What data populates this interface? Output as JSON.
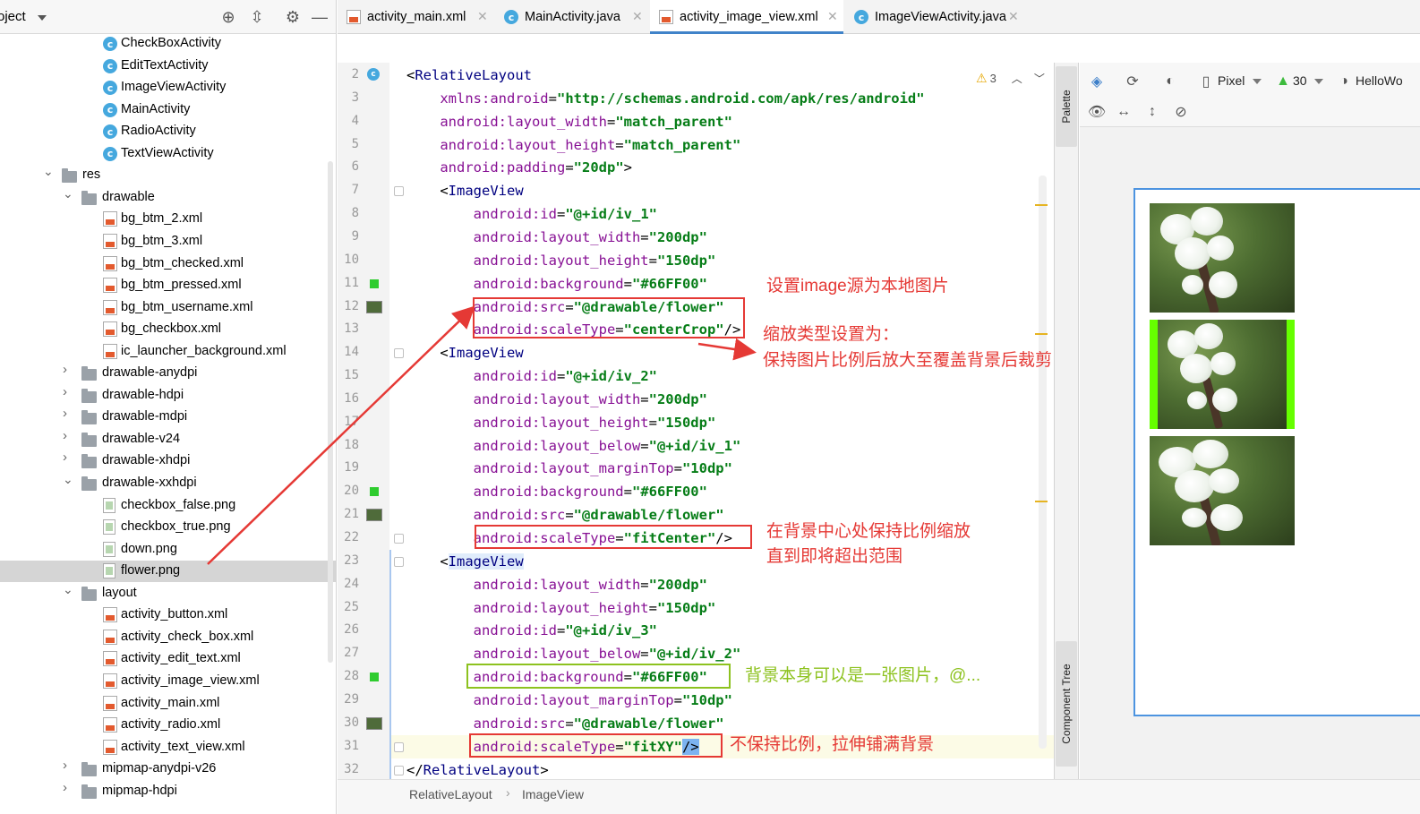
{
  "project_panel": {
    "title": "oject",
    "items": [
      {
        "label": "CheckBoxActivity",
        "kind": "class",
        "depth": 5
      },
      {
        "label": "EditTextActivity",
        "kind": "class",
        "depth": 5
      },
      {
        "label": "ImageViewActivity",
        "kind": "class",
        "depth": 5
      },
      {
        "label": "MainActivity",
        "kind": "class",
        "depth": 5
      },
      {
        "label": "RadioActivity",
        "kind": "class",
        "depth": 5
      },
      {
        "label": "TextViewActivity",
        "kind": "class",
        "depth": 5
      },
      {
        "label": "res",
        "kind": "folder",
        "depth": 2,
        "expanded": true
      },
      {
        "label": "drawable",
        "kind": "folder",
        "depth": 3,
        "expanded": true
      },
      {
        "label": "bg_btm_2.xml",
        "kind": "xml",
        "depth": 5
      },
      {
        "label": "bg_btm_3.xml",
        "kind": "xml",
        "depth": 5
      },
      {
        "label": "bg_btm_checked.xml",
        "kind": "xml",
        "depth": 5
      },
      {
        "label": "bg_btm_pressed.xml",
        "kind": "xml",
        "depth": 5
      },
      {
        "label": "bg_btm_username.xml",
        "kind": "xml",
        "depth": 5
      },
      {
        "label": "bg_checkbox.xml",
        "kind": "xml",
        "depth": 5
      },
      {
        "label": "ic_launcher_background.xml",
        "kind": "xml",
        "depth": 5
      },
      {
        "label": "drawable-anydpi",
        "kind": "folder",
        "depth": 3,
        "expanded": false
      },
      {
        "label": "drawable-hdpi",
        "kind": "folder",
        "depth": 3,
        "expanded": false
      },
      {
        "label": "drawable-mdpi",
        "kind": "folder",
        "depth": 3,
        "expanded": false
      },
      {
        "label": "drawable-v24",
        "kind": "folder",
        "depth": 3,
        "expanded": false
      },
      {
        "label": "drawable-xhdpi",
        "kind": "folder",
        "depth": 3,
        "expanded": false
      },
      {
        "label": "drawable-xxhdpi",
        "kind": "folder",
        "depth": 3,
        "expanded": true
      },
      {
        "label": "checkbox_false.png",
        "kind": "png",
        "depth": 5
      },
      {
        "label": "checkbox_true.png",
        "kind": "png",
        "depth": 5
      },
      {
        "label": "down.png",
        "kind": "png",
        "depth": 5
      },
      {
        "label": "flower.png",
        "kind": "png",
        "depth": 5,
        "selected": true
      },
      {
        "label": "layout",
        "kind": "folder",
        "depth": 3,
        "expanded": true
      },
      {
        "label": "activity_button.xml",
        "kind": "xml",
        "depth": 5
      },
      {
        "label": "activity_check_box.xml",
        "kind": "xml",
        "depth": 5
      },
      {
        "label": "activity_edit_text.xml",
        "kind": "xml",
        "depth": 5
      },
      {
        "label": "activity_image_view.xml",
        "kind": "xml",
        "depth": 5
      },
      {
        "label": "activity_main.xml",
        "kind": "xml",
        "depth": 5
      },
      {
        "label": "activity_radio.xml",
        "kind": "xml",
        "depth": 5
      },
      {
        "label": "activity_text_view.xml",
        "kind": "xml",
        "depth": 5
      },
      {
        "label": "mipmap-anydpi-v26",
        "kind": "folder",
        "depth": 3,
        "expanded": false
      },
      {
        "label": "mipmap-hdpi",
        "kind": "folder",
        "depth": 3,
        "expanded": false
      }
    ]
  },
  "tabs": [
    {
      "label": "activity_main.xml",
      "kind": "xml",
      "active": false
    },
    {
      "label": "MainActivity.java",
      "kind": "class",
      "active": false
    },
    {
      "label": "activity_image_view.xml",
      "kind": "xml",
      "active": true
    },
    {
      "label": "ImageViewActivity.java",
      "kind": "class",
      "active": false
    }
  ],
  "editor": {
    "warning_count": "3",
    "current_line": "31",
    "lines": [
      {
        "n": "2",
        "indent": 0,
        "parts": [
          [
            "pn",
            "<"
          ],
          [
            "tg",
            "RelativeLayout"
          ]
        ]
      },
      {
        "n": "3",
        "indent": 4,
        "parts": [
          [
            "an",
            "xmlns:android"
          ],
          [
            "pn",
            "="
          ],
          [
            "av",
            "\"http://schemas.android.com/apk/res/android\""
          ]
        ]
      },
      {
        "n": "4",
        "indent": 4,
        "parts": [
          [
            "an",
            "android:layout_width"
          ],
          [
            "pn",
            "="
          ],
          [
            "av",
            "\"match_parent\""
          ]
        ]
      },
      {
        "n": "5",
        "indent": 4,
        "parts": [
          [
            "an",
            "android:layout_height"
          ],
          [
            "pn",
            "="
          ],
          [
            "av",
            "\"match_parent\""
          ]
        ]
      },
      {
        "n": "6",
        "indent": 4,
        "parts": [
          [
            "an",
            "android:padding"
          ],
          [
            "pn",
            "="
          ],
          [
            "av",
            "\"20dp\""
          ],
          [
            "pn",
            ">"
          ]
        ]
      },
      {
        "n": "7",
        "indent": 4,
        "parts": [
          [
            "pn",
            "<"
          ],
          [
            "tg",
            "ImageView"
          ]
        ]
      },
      {
        "n": "8",
        "indent": 8,
        "parts": [
          [
            "an",
            "android:id"
          ],
          [
            "pn",
            "="
          ],
          [
            "av",
            "\"@+id/iv_1\""
          ]
        ]
      },
      {
        "n": "9",
        "indent": 8,
        "parts": [
          [
            "an",
            "android:layout_width"
          ],
          [
            "pn",
            "="
          ],
          [
            "av",
            "\"200dp\""
          ]
        ]
      },
      {
        "n": "10",
        "indent": 8,
        "parts": [
          [
            "an",
            "android:layout_height"
          ],
          [
            "pn",
            "="
          ],
          [
            "av",
            "\"150dp\""
          ]
        ]
      },
      {
        "n": "11",
        "indent": 8,
        "parts": [
          [
            "an",
            "android:background"
          ],
          [
            "pn",
            "="
          ],
          [
            "av",
            "\"#66FF00\""
          ]
        ]
      },
      {
        "n": "12",
        "indent": 8,
        "parts": [
          [
            "an",
            "android:src"
          ],
          [
            "pn",
            "="
          ],
          [
            "av",
            "\"@drawable/flower\""
          ]
        ]
      },
      {
        "n": "13",
        "indent": 8,
        "parts": [
          [
            "an",
            "android:scaleType"
          ],
          [
            "pn",
            "="
          ],
          [
            "av",
            "\"centerCrop\""
          ],
          [
            "pn",
            "/>"
          ]
        ]
      },
      {
        "n": "14",
        "indent": 4,
        "parts": [
          [
            "pn",
            "<"
          ],
          [
            "tg",
            "ImageView"
          ]
        ]
      },
      {
        "n": "15",
        "indent": 8,
        "parts": [
          [
            "an",
            "android:id"
          ],
          [
            "pn",
            "="
          ],
          [
            "av",
            "\"@+id/iv_2\""
          ]
        ]
      },
      {
        "n": "16",
        "indent": 8,
        "parts": [
          [
            "an",
            "android:layout_width"
          ],
          [
            "pn",
            "="
          ],
          [
            "av",
            "\"200dp\""
          ]
        ]
      },
      {
        "n": "17",
        "indent": 8,
        "parts": [
          [
            "an",
            "android:layout_height"
          ],
          [
            "pn",
            "="
          ],
          [
            "av",
            "\"150dp\""
          ]
        ]
      },
      {
        "n": "18",
        "indent": 8,
        "parts": [
          [
            "an",
            "android:layout_below"
          ],
          [
            "pn",
            "="
          ],
          [
            "av",
            "\"@+id/iv_1\""
          ]
        ]
      },
      {
        "n": "19",
        "indent": 8,
        "parts": [
          [
            "an",
            "android:layout_marginTop"
          ],
          [
            "pn",
            "="
          ],
          [
            "av",
            "\"10dp\""
          ]
        ]
      },
      {
        "n": "20",
        "indent": 8,
        "parts": [
          [
            "an",
            "android:background"
          ],
          [
            "pn",
            "="
          ],
          [
            "av",
            "\"#66FF00\""
          ]
        ]
      },
      {
        "n": "21",
        "indent": 8,
        "parts": [
          [
            "an",
            "android:src"
          ],
          [
            "pn",
            "="
          ],
          [
            "av",
            "\"@drawable/flower\""
          ]
        ]
      },
      {
        "n": "22",
        "indent": 8,
        "parts": [
          [
            "an",
            "android:scaleType"
          ],
          [
            "pn",
            "="
          ],
          [
            "av",
            "\"fitCenter\""
          ],
          [
            "pn",
            "/>"
          ]
        ]
      },
      {
        "n": "23",
        "indent": 4,
        "parts": [
          [
            "pn",
            "<"
          ],
          [
            "tg",
            "ImageView"
          ]
        ]
      },
      {
        "n": "24",
        "indent": 8,
        "parts": [
          [
            "an",
            "android:layout_width"
          ],
          [
            "pn",
            "="
          ],
          [
            "av",
            "\"200dp\""
          ]
        ]
      },
      {
        "n": "25",
        "indent": 8,
        "parts": [
          [
            "an",
            "android:layout_height"
          ],
          [
            "pn",
            "="
          ],
          [
            "av",
            "\"150dp\""
          ]
        ]
      },
      {
        "n": "26",
        "indent": 8,
        "parts": [
          [
            "an",
            "android:id"
          ],
          [
            "pn",
            "="
          ],
          [
            "av",
            "\"@+id/iv_3\""
          ]
        ]
      },
      {
        "n": "27",
        "indent": 8,
        "parts": [
          [
            "an",
            "android:layout_below"
          ],
          [
            "pn",
            "="
          ],
          [
            "av",
            "\"@+id/iv_2\""
          ]
        ]
      },
      {
        "n": "28",
        "indent": 8,
        "parts": [
          [
            "an",
            "android:background"
          ],
          [
            "pn",
            "="
          ],
          [
            "av",
            "\"#66FF00\""
          ]
        ]
      },
      {
        "n": "29",
        "indent": 8,
        "parts": [
          [
            "an",
            "android:layout_marginTop"
          ],
          [
            "pn",
            "="
          ],
          [
            "av",
            "\"10dp\""
          ]
        ]
      },
      {
        "n": "30",
        "indent": 8,
        "parts": [
          [
            "an",
            "android:src"
          ],
          [
            "pn",
            "="
          ],
          [
            "av",
            "\"@drawable/flower\""
          ]
        ]
      },
      {
        "n": "31",
        "indent": 8,
        "parts": [
          [
            "an",
            "android:scaleType"
          ],
          [
            "pn",
            "="
          ],
          [
            "av",
            "\"fitXY\""
          ],
          [
            "pn",
            "/>"
          ]
        ]
      },
      {
        "n": "32",
        "indent": 0,
        "parts": [
          [
            "pn",
            "</"
          ],
          [
            "tg",
            "RelativeLayout"
          ],
          [
            "pn",
            ">"
          ]
        ]
      }
    ]
  },
  "annotations": {
    "src_note": "设置image源为本地图片",
    "centercrop_note_1": "缩放类型设置为：",
    "centercrop_note_2": "保持图片比例后放大至覆盖背景后裁剪",
    "fitcenter_note_1": "在背景中心处保持比例缩放",
    "fitcenter_note_2": "直到即将超出范围",
    "background_note": "背景本身可以是一张图片，@...",
    "fitxy_note": "不保持比例，拉伸铺满背景",
    "red_color": "#e53935",
    "green_color": "#8dc21f"
  },
  "side_tabs": {
    "palette": "Palette",
    "component_tree": "Component Tree"
  },
  "design_toolbar": {
    "device": "Pixel",
    "api": "30",
    "theme": "HelloWo"
  },
  "preview": {
    "image_background": "#66FF00"
  },
  "status": {
    "crumb_1": "RelativeLayout",
    "crumb_2": "ImageView"
  }
}
